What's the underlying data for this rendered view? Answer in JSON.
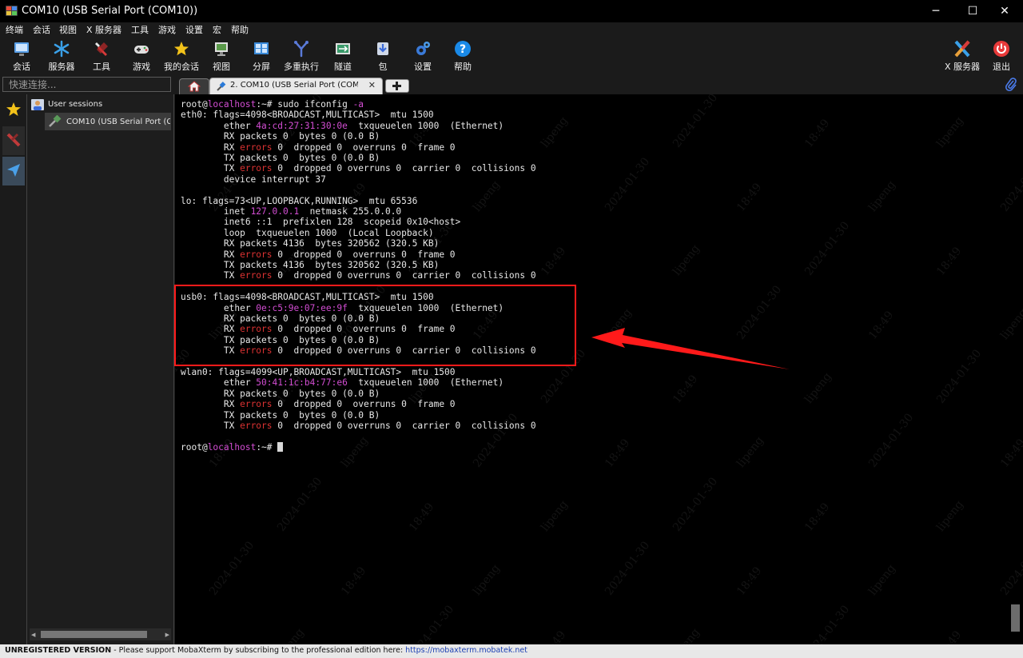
{
  "window": {
    "title": "COM10  (USB Serial Port (COM10))",
    "minimize": "─",
    "maximize": "☐",
    "close": "✕"
  },
  "menu": [
    "终端",
    "会话",
    "视图",
    "X 服务器",
    "工具",
    "游戏",
    "设置",
    "宏",
    "帮助"
  ],
  "toolbar": {
    "items": [
      "会话",
      "服务器",
      "工具",
      "游戏",
      "我的会话",
      "视图",
      "分屏",
      "多重执行",
      "隧道",
      "包",
      "设置",
      "帮助"
    ],
    "right_items": [
      "X 服务器",
      "退出"
    ]
  },
  "quick_connect": {
    "placeholder": "快速连接..."
  },
  "tabs": {
    "session_tab": "2. COM10  (USB Serial Port (COM10))",
    "close": "✕"
  },
  "tree": {
    "root": "User sessions",
    "child": "COM10  (USB Serial Port (COM10))"
  },
  "terminal": {
    "lines": [
      [
        {
          "t": "root@"
        },
        {
          "t": "localhost",
          "c": "host"
        },
        {
          "t": ":~# sudo ifconfig "
        },
        {
          "t": "-a",
          "c": "mag"
        }
      ],
      [
        {
          "t": "eth0: flags=4098<BROADCAST,MULTICAST>  mtu 1500"
        }
      ],
      [
        {
          "t": "        ether "
        },
        {
          "t": "4a:cd:27:31:30:0e",
          "c": "mag"
        },
        {
          "t": "  txqueuelen 1000  (Ethernet)"
        }
      ],
      [
        {
          "t": "        RX packets 0  bytes 0 (0.0 B)"
        }
      ],
      [
        {
          "t": "        RX "
        },
        {
          "t": "errors",
          "c": "red"
        },
        {
          "t": " 0  dropped 0  overruns 0  frame 0"
        }
      ],
      [
        {
          "t": "        TX packets 0  bytes 0 (0.0 B)"
        }
      ],
      [
        {
          "t": "        TX "
        },
        {
          "t": "errors",
          "c": "red"
        },
        {
          "t": " 0  dropped 0 overruns 0  carrier 0  collisions 0"
        }
      ],
      [
        {
          "t": "        device interrupt 37"
        }
      ],
      [
        {
          "t": ""
        }
      ],
      [
        {
          "t": "lo: flags=73<UP,LOOPBACK,RUNNING>  mtu 65536"
        }
      ],
      [
        {
          "t": "        inet "
        },
        {
          "t": "127.0.0.1",
          "c": "mag"
        },
        {
          "t": "  netmask 255.0.0.0"
        }
      ],
      [
        {
          "t": "        inet6 ::1  prefixlen 128  scopeid 0x10<host>"
        }
      ],
      [
        {
          "t": "        loop  txqueuelen 1000  (Local Loopback)"
        }
      ],
      [
        {
          "t": "        RX packets 4136  bytes 320562 (320.5 KB)"
        }
      ],
      [
        {
          "t": "        RX "
        },
        {
          "t": "errors",
          "c": "red"
        },
        {
          "t": " 0  dropped 0  overruns 0  frame 0"
        }
      ],
      [
        {
          "t": "        TX packets 4136  bytes 320562 (320.5 KB)"
        }
      ],
      [
        {
          "t": "        TX "
        },
        {
          "t": "errors",
          "c": "red"
        },
        {
          "t": " 0  dropped 0 overruns 0  carrier 0  collisions 0"
        }
      ],
      [
        {
          "t": ""
        }
      ],
      [
        {
          "t": "usb0: flags=4098<BROADCAST,MULTICAST>  mtu 1500"
        }
      ],
      [
        {
          "t": "        ether "
        },
        {
          "t": "0e:c5:9e:07:ee:9f",
          "c": "mag"
        },
        {
          "t": "  txqueuelen 1000  (Ethernet)"
        }
      ],
      [
        {
          "t": "        RX packets 0  bytes 0 (0.0 B)"
        }
      ],
      [
        {
          "t": "        RX "
        },
        {
          "t": "errors",
          "c": "red"
        },
        {
          "t": " 0  dropped 0  overruns 0  frame 0"
        }
      ],
      [
        {
          "t": "        TX packets 0  bytes 0 (0.0 B)"
        }
      ],
      [
        {
          "t": "        TX "
        },
        {
          "t": "errors",
          "c": "red"
        },
        {
          "t": " 0  dropped 0 overruns 0  carrier 0  collisions 0"
        }
      ],
      [
        {
          "t": ""
        }
      ],
      [
        {
          "t": "wlan0: flags=4099<UP,BROADCAST,MULTICAST>  mtu 1500"
        }
      ],
      [
        {
          "t": "        ether "
        },
        {
          "t": "50:41:1c:b4:77:e6",
          "c": "mag"
        },
        {
          "t": "  txqueuelen 1000  (Ethernet)"
        }
      ],
      [
        {
          "t": "        RX packets 0  bytes 0 (0.0 B)"
        }
      ],
      [
        {
          "t": "        RX "
        },
        {
          "t": "errors",
          "c": "red"
        },
        {
          "t": " 0  dropped 0  overruns 0  frame 0"
        }
      ],
      [
        {
          "t": "        TX packets 0  bytes 0 (0.0 B)"
        }
      ],
      [
        {
          "t": "        TX "
        },
        {
          "t": "errors",
          "c": "red"
        },
        {
          "t": " 0  dropped 0 overruns 0  carrier 0  collisions 0"
        }
      ],
      [
        {
          "t": ""
        }
      ],
      [
        {
          "t": "root@"
        },
        {
          "t": "localhost",
          "c": "host"
        },
        {
          "t": ":~# "
        },
        {
          "cursor": true
        }
      ]
    ]
  },
  "watermark": {
    "texts": [
      "lipeng",
      "2024-01-30",
      "18:49"
    ]
  },
  "status": {
    "unregistered": "UNREGISTERED VERSION",
    "message": "  -  Please support MobaXterm by subscribing to the professional edition here:  ",
    "link": "https://mobaxterm.mobatek.net"
  },
  "colors": {
    "host": "#d24dd2",
    "highlight": "#ff1a1a",
    "arrow": "#ff1a1a",
    "error": "#dc3232"
  },
  "icons": {
    "toolbar": [
      "session-icon",
      "servers-icon",
      "tools-icon",
      "games-icon",
      "my-sessions-star-icon",
      "view-icon",
      "split-icon",
      "multi-exec-icon",
      "tunnel-icon",
      "package-icon",
      "settings-icon",
      "help-icon"
    ],
    "sidebar": [
      "star-icon",
      "tools-icon",
      "send-icon"
    ]
  }
}
